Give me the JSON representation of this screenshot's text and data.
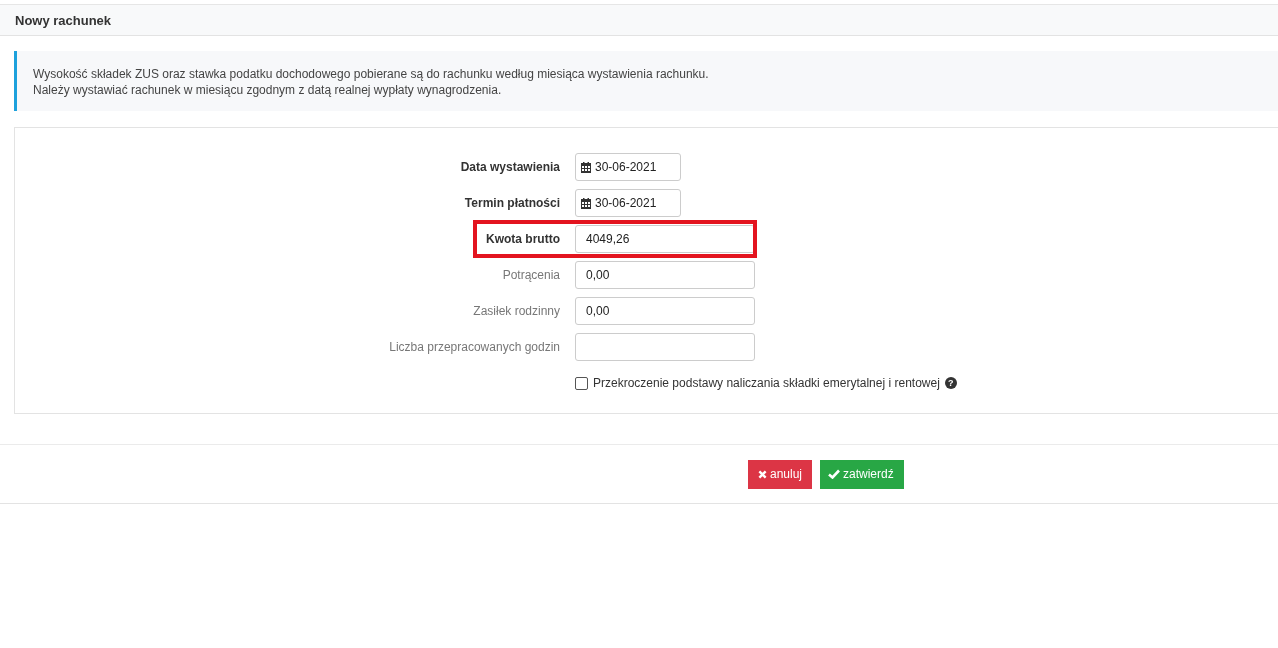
{
  "header": {
    "title": "Nowy rachunek"
  },
  "alert": {
    "lines": [
      "Wysokość składek ZUS oraz stawka podatku dochodowego pobierane są do rachunku według miesiąca wystawienia rachunku.",
      "Należy wystawiać rachunek w miesiącu zgodnym z datą realnej wypłaty wynagrodzenia."
    ]
  },
  "fields": [
    {
      "label": "Data wystawienia",
      "kind": "date",
      "value": "30-06-2021",
      "required": true,
      "highlighted": false
    },
    {
      "label": "Termin płatności",
      "kind": "date",
      "value": "30-06-2021",
      "required": true,
      "highlighted": false
    },
    {
      "label": "Kwota brutto",
      "kind": "text",
      "value": "4049,26",
      "required": true,
      "highlighted": true
    },
    {
      "label": "Potrącenia",
      "kind": "text",
      "value": "0,00",
      "required": false,
      "highlighted": false
    },
    {
      "label": "Zasiłek rodzinny",
      "kind": "text",
      "value": "0,00",
      "required": false,
      "highlighted": false
    },
    {
      "label": "Liczba przepracowanych godzin",
      "kind": "text",
      "required": false,
      "highlighted": false
    }
  ],
  "checkbox": {
    "label": "Przekroczenie podstawy naliczania składki emerytalnej i rentowej",
    "checked": false,
    "help": "?"
  },
  "buttons": [
    {
      "label": "anuluj",
      "kind": "cancel"
    },
    {
      "label": "zatwierdź",
      "kind": "confirm"
    }
  ]
}
